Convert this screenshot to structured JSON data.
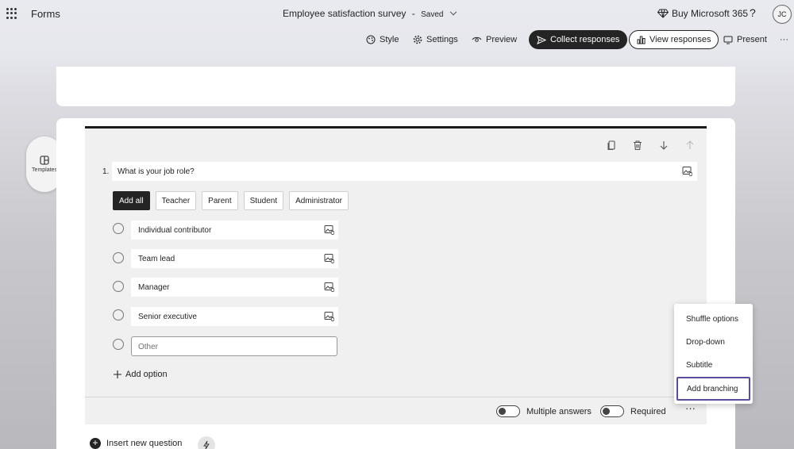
{
  "app": {
    "name": "Forms"
  },
  "document": {
    "title": "Employee satisfaction survey",
    "separator": "-",
    "status": "Saved"
  },
  "header": {
    "buy_label": "Buy Microsoft 365",
    "help_label": "?",
    "avatar_initials": "JC"
  },
  "toolbar": {
    "style_label": "Style",
    "settings_label": "Settings",
    "preview_label": "Preview",
    "collect_label": "Collect responses",
    "view_label": "View responses",
    "present_label": "Present",
    "more_label": "···"
  },
  "sidebar": {
    "templates_label": "Templates"
  },
  "question": {
    "number": "1.",
    "text": "What is your job role?",
    "suggestions": [
      "Add all",
      "Teacher",
      "Parent",
      "Student",
      "Administrator"
    ],
    "options": [
      "Individual contributor",
      "Team lead",
      "Manager",
      "Senior executive"
    ],
    "other_placeholder": "Other",
    "add_option_label": "Add option",
    "multiple_answers_label": "Multiple answers",
    "required_label": "Required",
    "more_label": "···"
  },
  "menu": {
    "items": [
      "Shuffle options",
      "Drop-down",
      "Subtitle",
      "Add branching"
    ]
  },
  "footer": {
    "insert_label": "Insert new question"
  }
}
